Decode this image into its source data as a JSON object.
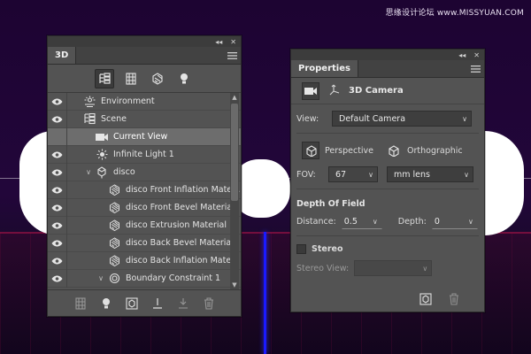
{
  "watermark": "思缘设计论坛  www.MISSYUAN.COM",
  "panel_3d": {
    "tab": "3D",
    "layers": [
      {
        "label": "Environment",
        "eye": true,
        "arrow": "",
        "icon": "environment-icon",
        "indent": 0
      },
      {
        "label": "Scene",
        "eye": true,
        "arrow": "",
        "icon": "scene-icon",
        "indent": 0
      },
      {
        "label": "Current View",
        "eye": false,
        "arrow": "",
        "icon": "camera-icon",
        "indent": 1,
        "selected": true
      },
      {
        "label": "Infinite Light 1",
        "eye": true,
        "arrow": "",
        "icon": "light-icon",
        "indent": 1
      },
      {
        "label": "disco",
        "eye": true,
        "arrow": "∨",
        "icon": "mesh-icon",
        "indent": 1
      },
      {
        "label": "disco Front Inflation Mate...",
        "eye": true,
        "arrow": "",
        "icon": "material-icon",
        "indent": 2
      },
      {
        "label": "disco Front Bevel Material",
        "eye": true,
        "arrow": "",
        "icon": "material-icon",
        "indent": 2
      },
      {
        "label": "disco Extrusion Material",
        "eye": true,
        "arrow": "",
        "icon": "material-icon",
        "indent": 2
      },
      {
        "label": "disco Back Bevel Material",
        "eye": true,
        "arrow": "",
        "icon": "material-icon",
        "indent": 2
      },
      {
        "label": "disco Back Inflation Mate...",
        "eye": true,
        "arrow": "",
        "icon": "material-icon",
        "indent": 2
      },
      {
        "label": "Boundary Constraint 1",
        "eye": true,
        "arrow": "∨",
        "icon": "constraint-icon",
        "indent": 2
      }
    ]
  },
  "panel_props": {
    "tab": "Properties",
    "header_title": "3D Camera",
    "view_label": "View:",
    "view_value": "Default Camera",
    "perspective_label": "Perspective",
    "orthographic_label": "Orthographic",
    "fov_label": "FOV:",
    "fov_value": "67",
    "fov_unit": "mm lens",
    "dof_title": "Depth Of Field",
    "distance_label": "Distance:",
    "distance_value": "0.5",
    "depth_label": "Depth:",
    "depth_value": "0",
    "stereo_label": "Stereo",
    "stereo_view_label": "Stereo View:",
    "stereo_view_value": ""
  }
}
